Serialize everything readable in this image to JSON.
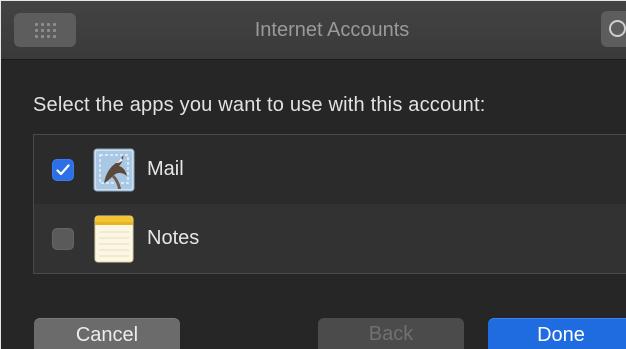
{
  "window": {
    "title": "Internet Accounts"
  },
  "titlebar": {
    "grid_icon": "grid-icon",
    "search_icon": "search-icon"
  },
  "main": {
    "prompt": "Select the apps you want to use with this account:",
    "apps": [
      {
        "label": "Mail",
        "checked": true,
        "icon": "mail-icon"
      },
      {
        "label": "Notes",
        "checked": false,
        "icon": "notes-icon"
      }
    ]
  },
  "footer": {
    "cancel_label": "Cancel",
    "back_label": "Back",
    "done_label": "Done"
  },
  "colors": {
    "accent": "#1e6ce0",
    "background": "#262626"
  }
}
